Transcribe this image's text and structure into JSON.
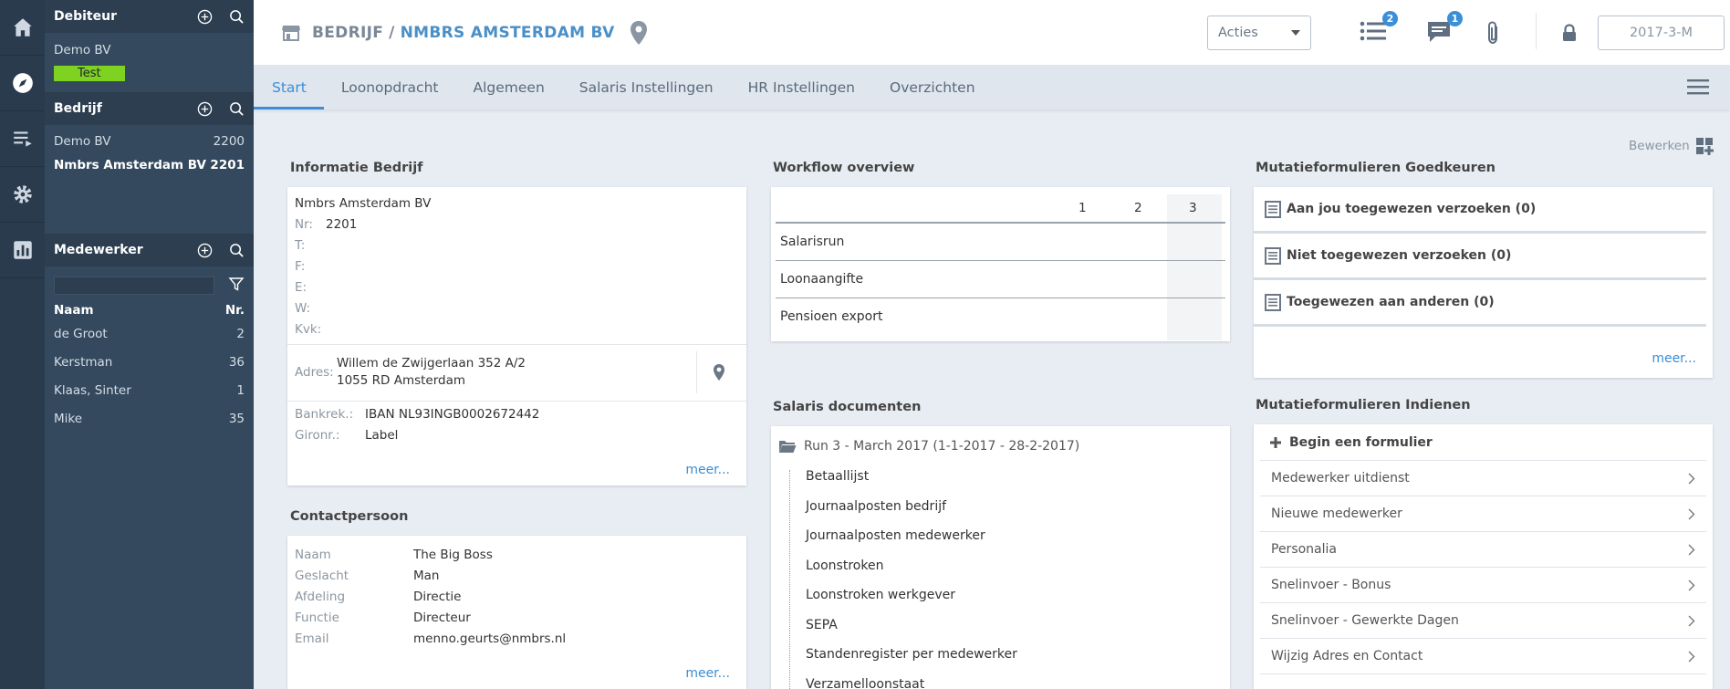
{
  "rail": {
    "icons": [
      "home-icon",
      "compass-icon",
      "list-icon",
      "gear-icon",
      "chart-icon"
    ]
  },
  "debiteur": {
    "title": "Debiteur",
    "name": "Demo BV",
    "badge": "Test"
  },
  "bedrijf": {
    "title": "Bedrijf",
    "items": [
      {
        "name": "Demo BV",
        "nr": "2200"
      },
      {
        "name": "Nmbrs Amsterdam BV",
        "nr": "2201"
      }
    ]
  },
  "medewerker": {
    "title": "Medewerker",
    "col_name": "Naam",
    "col_nr": "Nr.",
    "items": [
      {
        "name": "de Groot",
        "nr": "2"
      },
      {
        "name": "Kerstman",
        "nr": "36"
      },
      {
        "name": "Klaas, Sinter",
        "nr": "1"
      },
      {
        "name": "Mike",
        "nr": "35"
      }
    ]
  },
  "header": {
    "crumb_prefix": "BEDRIJF",
    "crumb_sep": "/",
    "crumb_company": "NMBRS AMSTERDAM BV",
    "acties": "Acties",
    "list_badge": "2",
    "msg_badge": "1",
    "period": "2017-3-M"
  },
  "tabs": [
    "Start",
    "Loonopdracht",
    "Algemeen",
    "Salaris Instellingen",
    "HR Instellingen",
    "Overzichten"
  ],
  "bewerken": "Bewerken",
  "info": {
    "title": "Informatie Bedrijf",
    "company": "Nmbrs Amsterdam BV",
    "nr_label": "Nr:",
    "nr": "2201",
    "t_label": "T:",
    "f_label": "F:",
    "e_label": "E:",
    "w_label": "W:",
    "kvk_label": "Kvk:",
    "adres_label": "Adres:",
    "adres_line1": "Willem de Zwijgerlaan 352 A/2",
    "adres_line2": "1055 RD Amsterdam",
    "bank_label": "Bankrek.:",
    "bank": "IBAN NL93INGB0002672442",
    "giro_label": "Gironr.:",
    "giro": "Label",
    "meer": "meer..."
  },
  "contact": {
    "title": "Contactpersoon",
    "rows": [
      {
        "k": "Naam",
        "v": "The Big Boss"
      },
      {
        "k": "Geslacht",
        "v": "Man"
      },
      {
        "k": "Afdeling",
        "v": "Directie"
      },
      {
        "k": "Functie",
        "v": "Directeur"
      },
      {
        "k": "Email",
        "v": "menno.geurts@nmbrs.nl"
      }
    ],
    "meer": "meer..."
  },
  "workflow": {
    "title": "Workflow overview",
    "cols": [
      "1",
      "2",
      "3"
    ],
    "rows": [
      "Salarisrun",
      "Loonaangifte",
      "Pensioen export"
    ]
  },
  "documents": {
    "title": "Salaris documenten",
    "folder": "Run 3 - March 2017 (1-1-2017 - 28-2-2017)",
    "items": [
      "Betaallijst",
      "Journaalposten bedrijf",
      "Journaalposten medewerker",
      "Loonstroken",
      "Loonstroken werkgever",
      "SEPA",
      "Standenregister per medewerker",
      "Verzamelloonstaat"
    ]
  },
  "goedkeuren": {
    "title": "Mutatieformulieren Goedkeuren",
    "items": [
      "Aan jou toegewezen verzoeken (0)",
      "Niet toegewezen verzoeken (0)",
      "Toegewezen aan anderen (0)"
    ],
    "meer": "meer..."
  },
  "indienen": {
    "title": "Mutatieformulieren Indienen",
    "begin": "Begin een formulier",
    "items": [
      "Medewerker uitdienst",
      "Nieuwe medewerker",
      "Personalia",
      "Snelinvoer - Bonus",
      "Snelinvoer - Gewerkte Dagen",
      "Wijzig Adres en Contact"
    ]
  },
  "colors": {
    "accent": "#3b8ed8",
    "sidebar": "#34495e",
    "rail": "#2b3b4e",
    "test_badge": "#7ed321"
  }
}
